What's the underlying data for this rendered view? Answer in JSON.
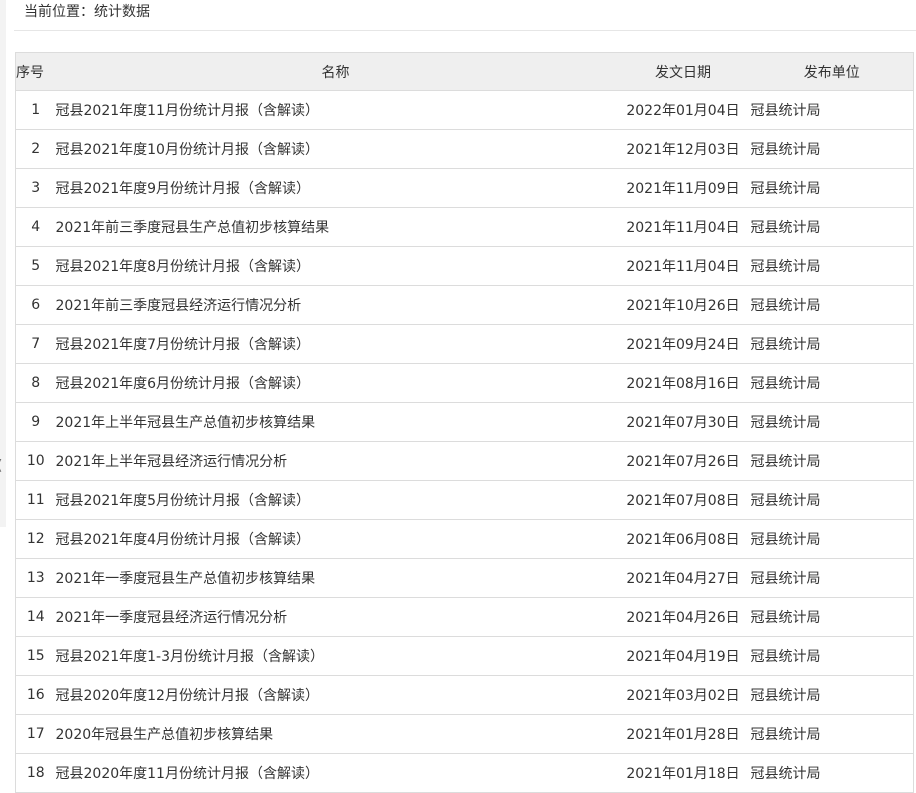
{
  "breadcrumb": {
    "label": "当前位置：",
    "current": "统计数据"
  },
  "table": {
    "headers": {
      "index": "序号",
      "title": "名称",
      "date": "发文日期",
      "unit": "发布单位"
    },
    "rows": [
      {
        "index": "1",
        "title": "冠县2021年度11月份统计月报（含解读）",
        "date": "2022年01月04日",
        "unit": "冠县统计局"
      },
      {
        "index": "2",
        "title": "冠县2021年度10月份统计月报（含解读）",
        "date": "2021年12月03日",
        "unit": "冠县统计局"
      },
      {
        "index": "3",
        "title": "冠县2021年度9月份统计月报（含解读）",
        "date": "2021年11月09日",
        "unit": "冠县统计局"
      },
      {
        "index": "4",
        "title": "2021年前三季度冠县生产总值初步核算结果",
        "date": "2021年11月04日",
        "unit": "冠县统计局"
      },
      {
        "index": "5",
        "title": "冠县2021年度8月份统计月报（含解读）",
        "date": "2021年11月04日",
        "unit": "冠县统计局"
      },
      {
        "index": "6",
        "title": "2021年前三季度冠县经济运行情况分析",
        "date": "2021年10月26日",
        "unit": "冠县统计局"
      },
      {
        "index": "7",
        "title": "冠县2021年度7月份统计月报（含解读）",
        "date": "2021年09月24日",
        "unit": "冠县统计局"
      },
      {
        "index": "8",
        "title": "冠县2021年度6月份统计月报（含解读）",
        "date": "2021年08月16日",
        "unit": "冠县统计局"
      },
      {
        "index": "9",
        "title": "2021年上半年冠县生产总值初步核算结果",
        "date": "2021年07月30日",
        "unit": "冠县统计局"
      },
      {
        "index": "10",
        "title": "2021年上半年冠县经济运行情况分析",
        "date": "2021年07月26日",
        "unit": "冠县统计局"
      },
      {
        "index": "11",
        "title": "冠县2021年度5月份统计月报（含解读）",
        "date": "2021年07月08日",
        "unit": "冠县统计局"
      },
      {
        "index": "12",
        "title": "冠县2021年度4月份统计月报（含解读）",
        "date": "2021年06月08日",
        "unit": "冠县统计局"
      },
      {
        "index": "13",
        "title": "2021年一季度冠县生产总值初步核算结果",
        "date": "2021年04月27日",
        "unit": "冠县统计局"
      },
      {
        "index": "14",
        "title": "2021年一季度冠县经济运行情况分析",
        "date": "2021年04月26日",
        "unit": "冠县统计局"
      },
      {
        "index": "15",
        "title": "冠县2021年度1-3月份统计月报（含解读）",
        "date": "2021年04月19日",
        "unit": "冠县统计局"
      },
      {
        "index": "16",
        "title": "冠县2020年度12月份统计月报（含解读）",
        "date": "2021年03月02日",
        "unit": "冠县统计局"
      },
      {
        "index": "17",
        "title": "2020年冠县生产总值初步核算结果",
        "date": "2021年01月28日",
        "unit": "冠县统计局"
      },
      {
        "index": "18",
        "title": "冠县2020年度11月份统计月报（含解读）",
        "date": "2021年01月18日",
        "unit": "冠县统计局"
      }
    ]
  },
  "sidebar_fragment": {
    "glyph": "("
  }
}
